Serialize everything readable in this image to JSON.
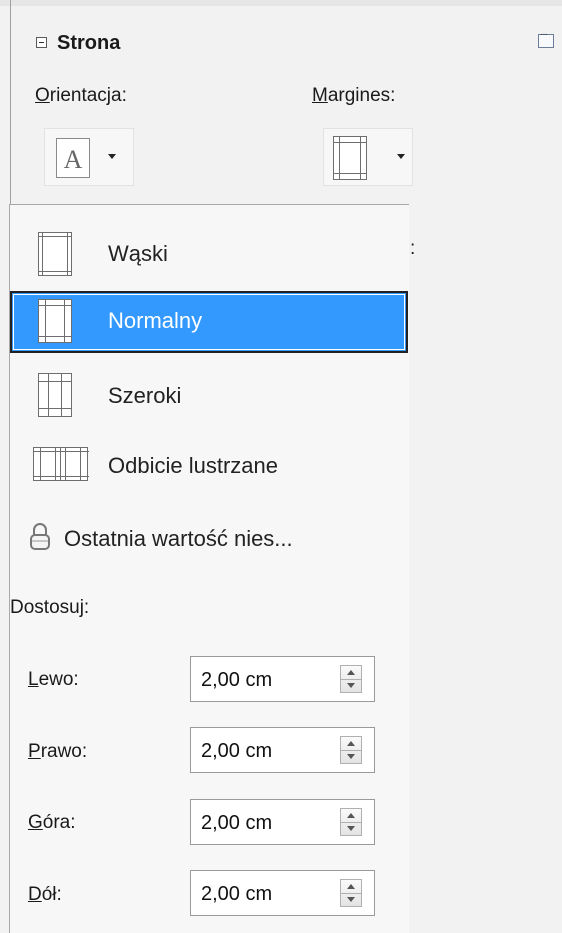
{
  "section": {
    "title": "Strona",
    "collapse_symbol": "−"
  },
  "orientation": {
    "label_underlined": "O",
    "label_rest": "rientacja:"
  },
  "margins": {
    "label_underlined": "M",
    "label_rest": "argines:"
  },
  "hidden_label_fragment": ":",
  "margin_presets": [
    {
      "label": "Wąski",
      "icon": "narrow-margin-page-icon",
      "selected": false
    },
    {
      "label": "Normalny",
      "icon": "normal-margin-page-icon",
      "selected": true
    },
    {
      "label": "Szeroki",
      "icon": "wide-margin-page-icon",
      "selected": false
    },
    {
      "label": "Odbicie lustrzane",
      "icon": "mirrored-margin-pages-icon",
      "selected": false
    },
    {
      "label": "Ostatnia wartość nies...",
      "icon": "lock-icon",
      "selected": false
    }
  ],
  "custom": {
    "heading": "Dostosuj:",
    "fields": [
      {
        "label_underlined": "L",
        "label_rest": "ewo:",
        "value": "2,00 cm"
      },
      {
        "label_underlined": "P",
        "label_rest": "rawo:",
        "value": "2,00 cm"
      },
      {
        "label_underlined": "G",
        "label_rest": "óra:",
        "value": "2,00 cm"
      },
      {
        "label_underlined": "D",
        "label_rest": "ół:",
        "value": "2,00 cm"
      }
    ]
  },
  "colors": {
    "selection": "#3399ff",
    "background": "#f2f2f2"
  }
}
